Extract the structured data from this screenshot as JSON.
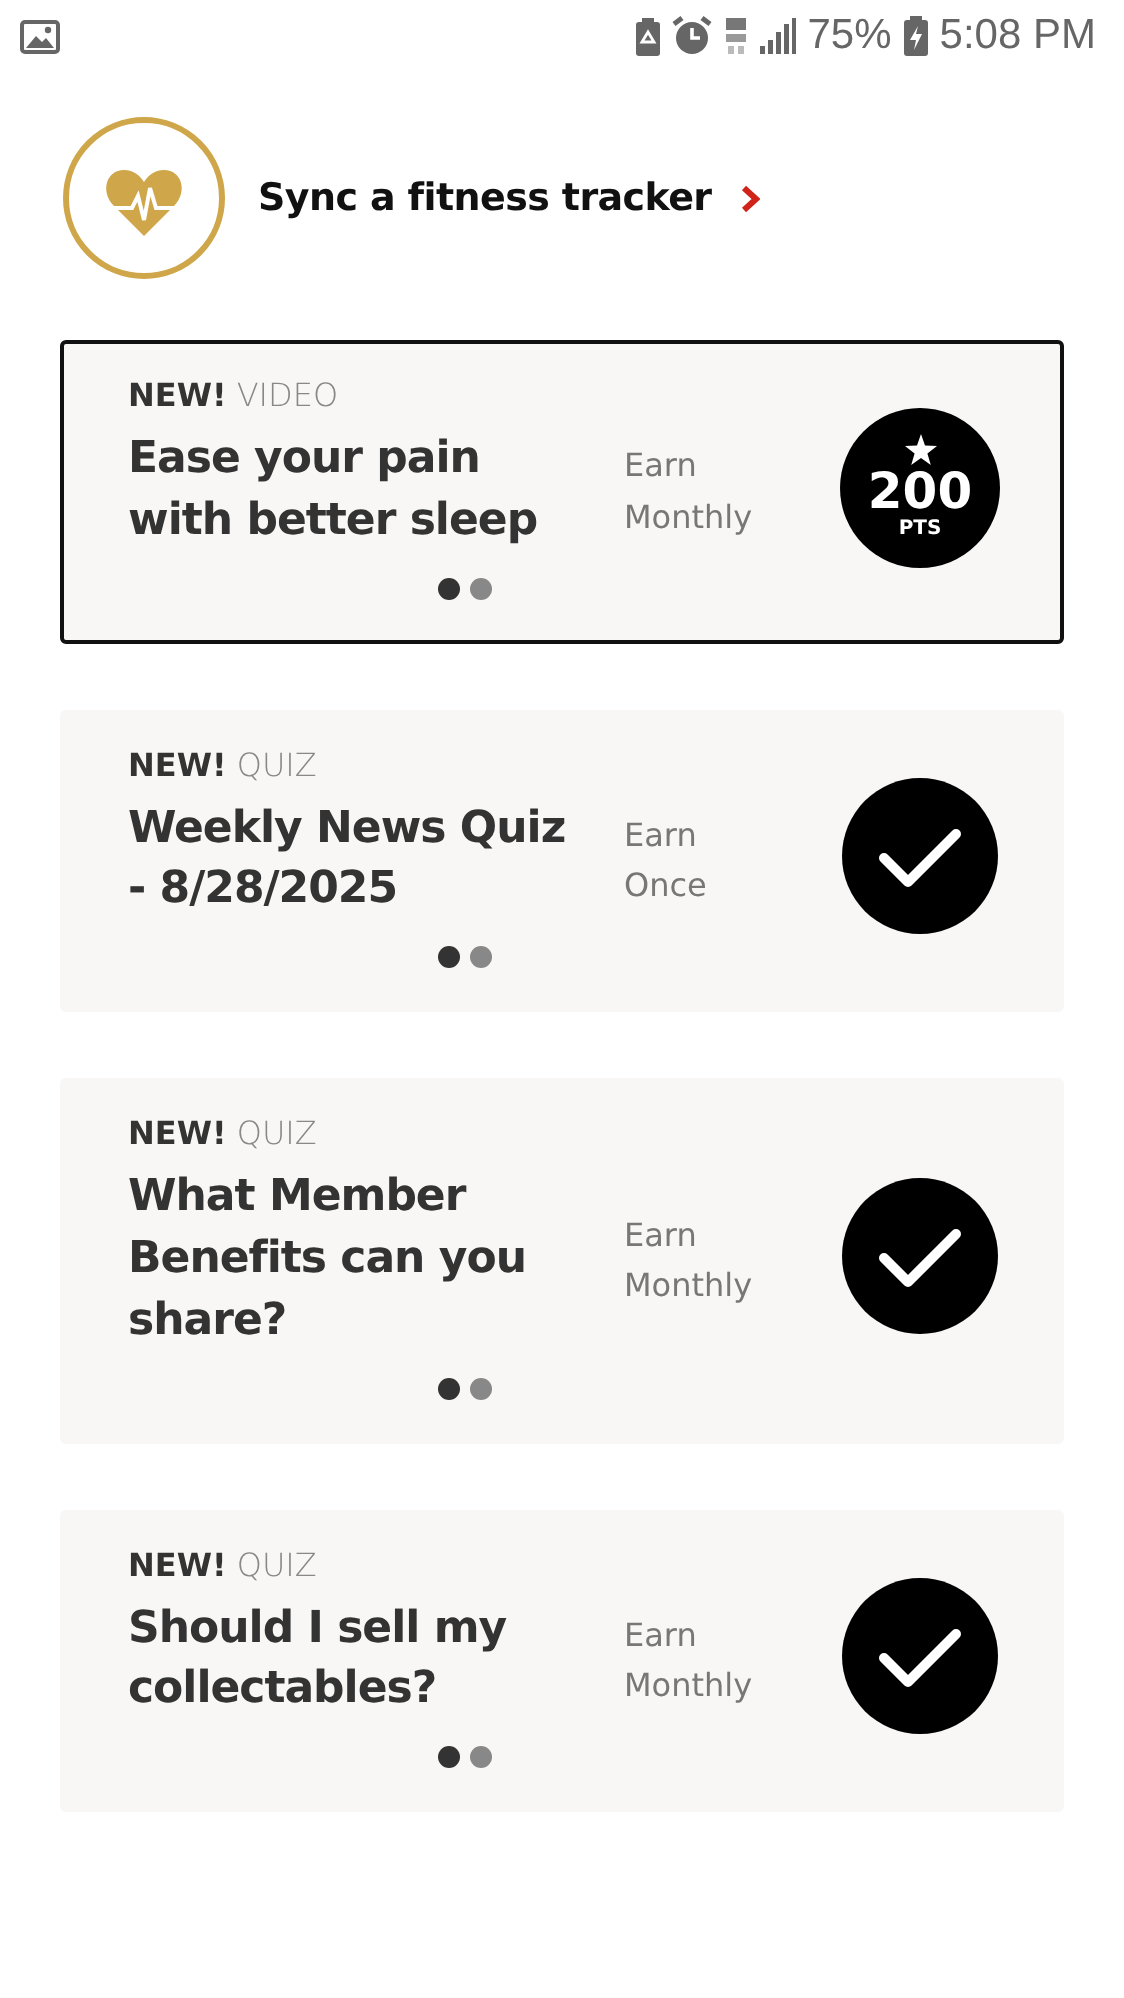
{
  "status_bar": {
    "battery_percent": "75%",
    "time": "5:08 PM"
  },
  "sync": {
    "label": "Sync a fitness tracker"
  },
  "cards": [
    {
      "tag": "NEW!",
      "type": "VIDEO",
      "title": "Ease your pain with better sleep",
      "earn": [
        "Earn",
        "Monthly"
      ],
      "selected": true,
      "badge": {
        "kind": "points",
        "value": "200",
        "unit": "PTS"
      },
      "pages": [
        {
          "selected": true
        },
        {
          "selected": false
        }
      ]
    },
    {
      "tag": "NEW!",
      "type": "QUIZ",
      "title": "Weekly News Quiz - 8/28/2025",
      "earn": [
        "Earn",
        "Once"
      ],
      "selected": false,
      "badge": {
        "kind": "done"
      },
      "pages": [
        {
          "selected": true
        },
        {
          "selected": false
        }
      ]
    },
    {
      "tag": "NEW!",
      "type": "QUIZ",
      "title": "What Member Benefits can you share?",
      "earn": [
        "Earn",
        "Monthly"
      ],
      "selected": false,
      "badge": {
        "kind": "done"
      },
      "pages": [
        {
          "selected": true
        },
        {
          "selected": false
        }
      ]
    },
    {
      "tag": "NEW!",
      "type": "QUIZ",
      "title": "Should I sell my collectables?",
      "earn": [
        "Earn",
        "Monthly"
      ],
      "selected": false,
      "badge": {
        "kind": "done"
      },
      "pages": [
        {
          "selected": true
        },
        {
          "selected": false
        }
      ]
    }
  ]
}
